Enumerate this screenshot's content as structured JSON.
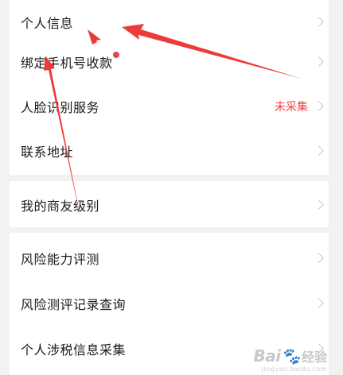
{
  "menu": {
    "group1": [
      {
        "label": "个人信息",
        "status": ""
      },
      {
        "label": "绑定手机号收款",
        "status": ""
      },
      {
        "label": "人脸识别服务",
        "status": "未采集"
      },
      {
        "label": "联系地址",
        "status": ""
      }
    ],
    "group2": [
      {
        "label": "我的商友级别",
        "status": ""
      }
    ],
    "group3": [
      {
        "label": "风险能力评测",
        "status": ""
      },
      {
        "label": "风险测评记录查询",
        "status": ""
      },
      {
        "label": "个人涉税信息采集",
        "status": ""
      }
    ]
  },
  "watermark": {
    "logo": "Bai",
    "logo_tail": "经验",
    "url": "jingyan.baidu.com"
  },
  "colors": {
    "background": "#f2f2f2",
    "card": "#ffffff",
    "accent_red": "#e6454a",
    "arrow_red": "#ec3b3b",
    "chevron": "#c8c8c8"
  },
  "icons": {
    "chevron": "chevron-right-icon",
    "badge": "red-dot-badge",
    "annotation": "red-arrow-annotation"
  }
}
